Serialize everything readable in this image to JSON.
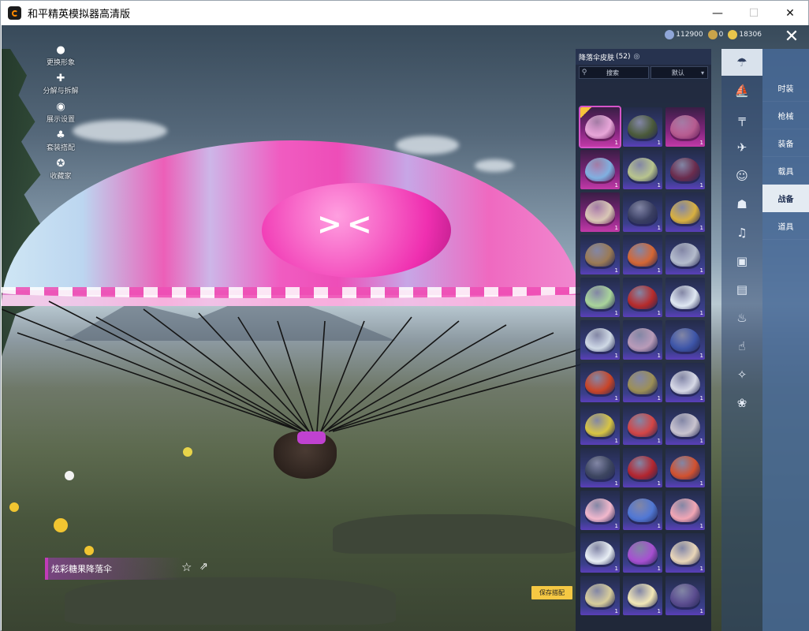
{
  "window": {
    "title": "和平精英模拟器高清版",
    "controls": {
      "minimize": "—",
      "maximize": "☐",
      "close": "✕"
    }
  },
  "left_menu": [
    {
      "icon": "person-icon",
      "glyph": "●",
      "label": "更换形象"
    },
    {
      "icon": "puzzle-icon",
      "glyph": "✚",
      "label": "分解与拆解"
    },
    {
      "icon": "eye-icon",
      "glyph": "◉",
      "label": "展示设置"
    },
    {
      "icon": "outfit-icon",
      "glyph": "♣",
      "label": "套装搭配"
    },
    {
      "icon": "collection-icon",
      "glyph": "✪",
      "label": "收藏家"
    }
  ],
  "currency": [
    {
      "icon": "coupon-icon",
      "value": "112900",
      "color": "#8fa6d8"
    },
    {
      "icon": "token-icon",
      "value": "0",
      "color": "#c8a34a"
    },
    {
      "icon": "coin-icon",
      "value": "18306",
      "color": "#e8c54c"
    }
  ],
  "panel": {
    "title": "降落伞皮肤",
    "count": "(52)",
    "search_placeholder": "搜索",
    "sort_label": "默认"
  },
  "tiles": [
    {
      "rarity": "legend",
      "color": "#e7a6d8",
      "count": "1",
      "selected": true,
      "badge": true
    },
    {
      "rarity": "epic",
      "color": "#4b5a3a",
      "count": "1"
    },
    {
      "rarity": "legend",
      "color": "#b65b8f",
      "count": "1"
    },
    {
      "rarity": "legend",
      "color": "#7fb0e0",
      "count": "1"
    },
    {
      "rarity": "epic",
      "color": "#b8c48d",
      "count": "1"
    },
    {
      "rarity": "epic",
      "color": "#6a2c4d",
      "count": "1"
    },
    {
      "rarity": "legend",
      "color": "#d9c7b5",
      "count": "1"
    },
    {
      "rarity": "epic",
      "color": "#3a3f62",
      "count": "1"
    },
    {
      "rarity": "epic",
      "color": "#d8b040",
      "count": "1"
    },
    {
      "rarity": "epic",
      "color": "#9a7a55",
      "count": "1"
    },
    {
      "rarity": "epic",
      "color": "#d46634",
      "count": "1"
    },
    {
      "rarity": "epic",
      "color": "#b4bccc",
      "count": "1"
    },
    {
      "rarity": "epic",
      "color": "#a9d49a",
      "count": "1"
    },
    {
      "rarity": "epic",
      "color": "#b62b2b",
      "count": "1"
    },
    {
      "rarity": "epic",
      "color": "#dfe8f2",
      "count": "1"
    },
    {
      "rarity": "epic",
      "color": "#cfd9e5",
      "count": "1"
    },
    {
      "rarity": "epic",
      "color": "#b99bb8",
      "count": "1"
    },
    {
      "rarity": "epic",
      "color": "#3d55a8",
      "count": "1"
    },
    {
      "rarity": "epic",
      "color": "#c94528",
      "count": "1"
    },
    {
      "rarity": "epic",
      "color": "#9c8f56",
      "count": "1"
    },
    {
      "rarity": "epic",
      "color": "#d7d9e6",
      "count": "1"
    },
    {
      "rarity": "epic",
      "color": "#d7c443",
      "count": "1"
    },
    {
      "rarity": "epic",
      "color": "#d24545",
      "count": "1"
    },
    {
      "rarity": "epic",
      "color": "#c9c4cf",
      "count": "1"
    },
    {
      "rarity": "epic",
      "color": "#3d4660",
      "count": "1"
    },
    {
      "rarity": "epic",
      "color": "#b3262f",
      "count": "1"
    },
    {
      "rarity": "epic",
      "color": "#d1512f",
      "count": "1"
    },
    {
      "rarity": "epic",
      "color": "#f2b8cc",
      "count": "1"
    },
    {
      "rarity": "epic",
      "color": "#5077d4",
      "count": "1"
    },
    {
      "rarity": "epic",
      "color": "#f2a6b4",
      "count": "1"
    },
    {
      "rarity": "epic",
      "color": "#e8eef4",
      "count": "1"
    },
    {
      "rarity": "epic",
      "color": "#a64fd0",
      "count": "1"
    },
    {
      "rarity": "epic",
      "color": "#e9d6b8",
      "count": "1"
    },
    {
      "rarity": "epic",
      "color": "#d7cc9b",
      "count": "1"
    },
    {
      "rarity": "epic",
      "color": "#f2e7b6",
      "count": "1"
    },
    {
      "rarity": "epic",
      "color": "#5a4c8e",
      "count": "1"
    }
  ],
  "category_icons": [
    {
      "icon": "parachute-icon",
      "glyph": "☂",
      "active": true
    },
    {
      "icon": "boat-icon",
      "glyph": "⛵"
    },
    {
      "icon": "gun-icon",
      "glyph": "╤"
    },
    {
      "icon": "plane-icon",
      "glyph": "✈"
    },
    {
      "icon": "emote-icon",
      "glyph": "☺"
    },
    {
      "icon": "robot-icon",
      "glyph": "☗"
    },
    {
      "icon": "sound-icon",
      "glyph": "♫"
    },
    {
      "icon": "frame-icon",
      "glyph": "▣"
    },
    {
      "icon": "picture-icon",
      "glyph": "▤"
    },
    {
      "icon": "spray-icon",
      "glyph": "♨"
    },
    {
      "icon": "gesture-icon",
      "glyph": "☝"
    },
    {
      "icon": "wand-icon",
      "glyph": "✧"
    },
    {
      "icon": "pet-icon",
      "glyph": "❀"
    }
  ],
  "tabs": [
    {
      "label": "时装"
    },
    {
      "label": "枪械"
    },
    {
      "label": "装备"
    },
    {
      "label": "载具"
    },
    {
      "label": "战备",
      "active": true
    },
    {
      "label": "道具"
    }
  ],
  "item": {
    "name": "炫彩糖果降落伞"
  },
  "save_button": "保存搭配"
}
